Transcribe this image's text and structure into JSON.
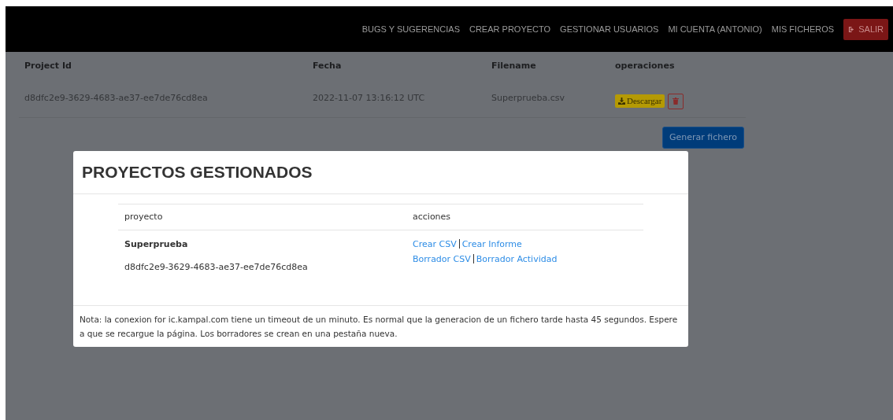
{
  "navbar": {
    "links": [
      "BUGS Y SUGERENCIAS",
      "CREAR PROYECTO",
      "GESTIONAR USUARIOS",
      "MI CUENTA (ANTONIO)",
      "MIS FICHEROS"
    ],
    "logout": "SALIR"
  },
  "files_table": {
    "columns": [
      "Project Id",
      "Fecha",
      "Filename",
      "operaciones"
    ],
    "rows": [
      {
        "project_id": "d8dfc2e9-3629-4683-ae37-ee7de76cd8ea",
        "fecha": "2022-11-07 13:16:12 UTC",
        "filename": "Superprueba.csv",
        "download": "Descargar"
      }
    ]
  },
  "generate_button": "Generar fichero",
  "modal": {
    "title": "PROYECTOS GESTIONADOS",
    "columns": [
      "proyecto",
      "acciones"
    ],
    "rows": [
      {
        "name": "Superprueba",
        "id": "d8dfc2e9-3629-4683-ae37-ee7de76cd8ea",
        "actions": [
          [
            "Crear CSV",
            "Crear Informe"
          ],
          [
            "Borrador CSV",
            "Borrador Actividad"
          ]
        ]
      }
    ],
    "note": "Nota: la conexion for ic.kampal.com tiene un timeout de un minuto. Es normal que la generacion de un fichero tarde hasta 45 segundos. Espere a que se recargue la página. Los borradores se crean en una pestaña nueva."
  }
}
